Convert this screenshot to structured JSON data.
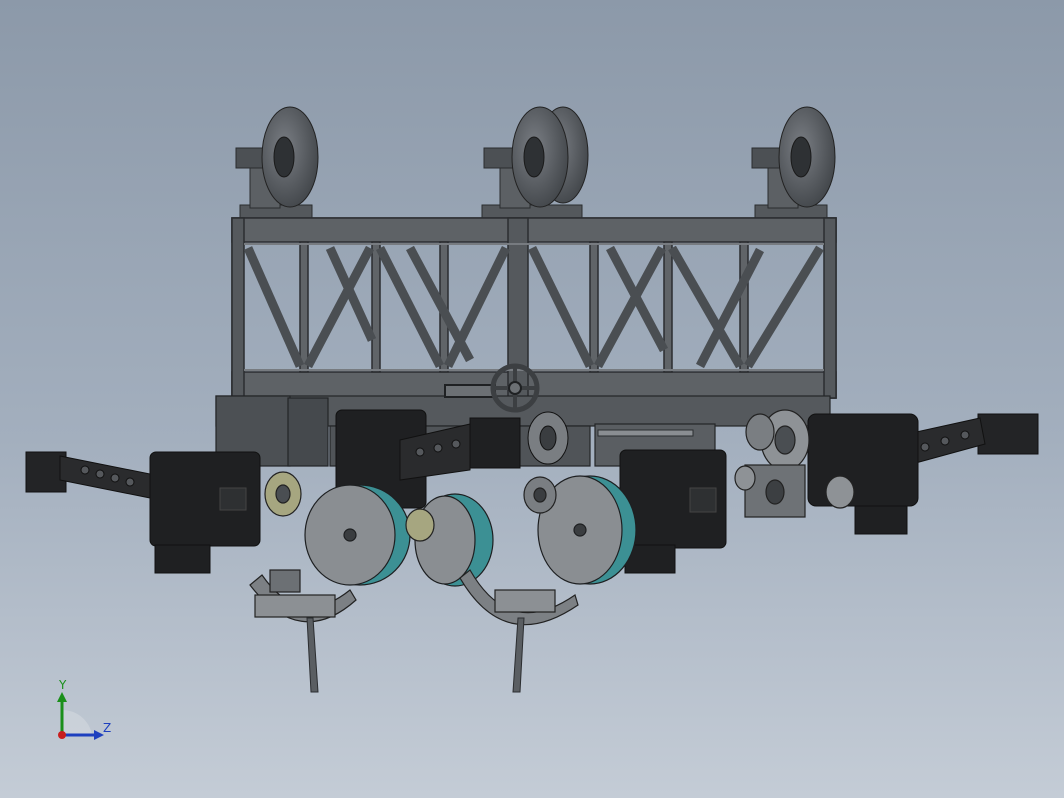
{
  "viewport": {
    "background_top": "#8c99a9",
    "background_bottom": "#c4ccd6"
  },
  "triad": {
    "y_label": "Y",
    "z_label": "Z",
    "y_color": "#1a8f1a",
    "z_color": "#1d3fbf",
    "x_color": "#c81e1e"
  }
}
